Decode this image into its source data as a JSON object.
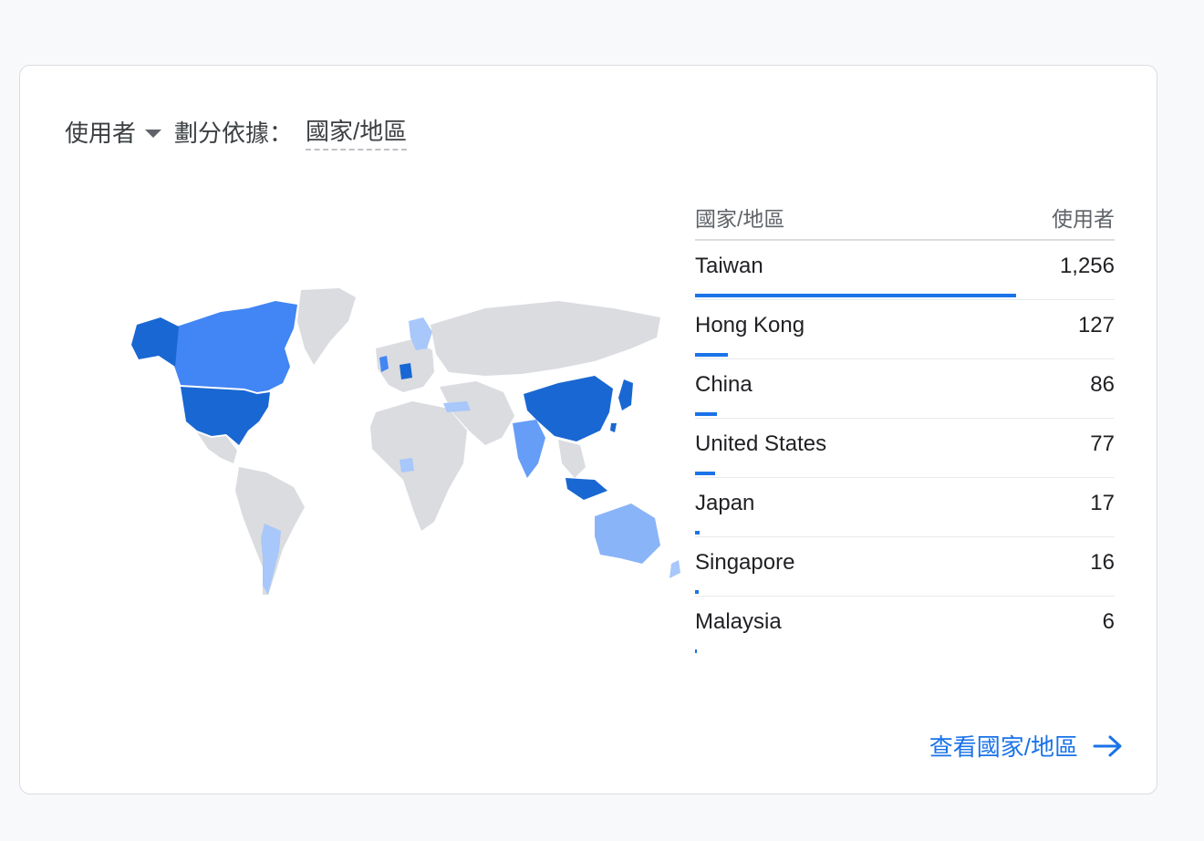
{
  "header": {
    "metric": "使用者",
    "dimension_label": "劃分依據：",
    "dimension_value": "國家/地區"
  },
  "table": {
    "col_country": "國家/地區",
    "col_users": "使用者",
    "rows": [
      {
        "name": "Taiwan",
        "value": "1,256",
        "count": 1256
      },
      {
        "name": "Hong Kong",
        "value": "127",
        "count": 127
      },
      {
        "name": "China",
        "value": "86",
        "count": 86
      },
      {
        "name": "United States",
        "value": "77",
        "count": 77
      },
      {
        "name": "Japan",
        "value": "17",
        "count": 17
      },
      {
        "name": "Singapore",
        "value": "16",
        "count": 16
      },
      {
        "name": "Malaysia",
        "value": "6",
        "count": 6
      }
    ]
  },
  "footer": {
    "link_label": "查看國家/地區",
    "icon": "arrow-right-icon"
  },
  "map": {
    "icon": "world-map",
    "colors": {
      "none": "#dadce0",
      "low": "#a8c7fa",
      "mid": "#669df6",
      "high": "#4285f4",
      "top": "#1967d2"
    }
  }
}
